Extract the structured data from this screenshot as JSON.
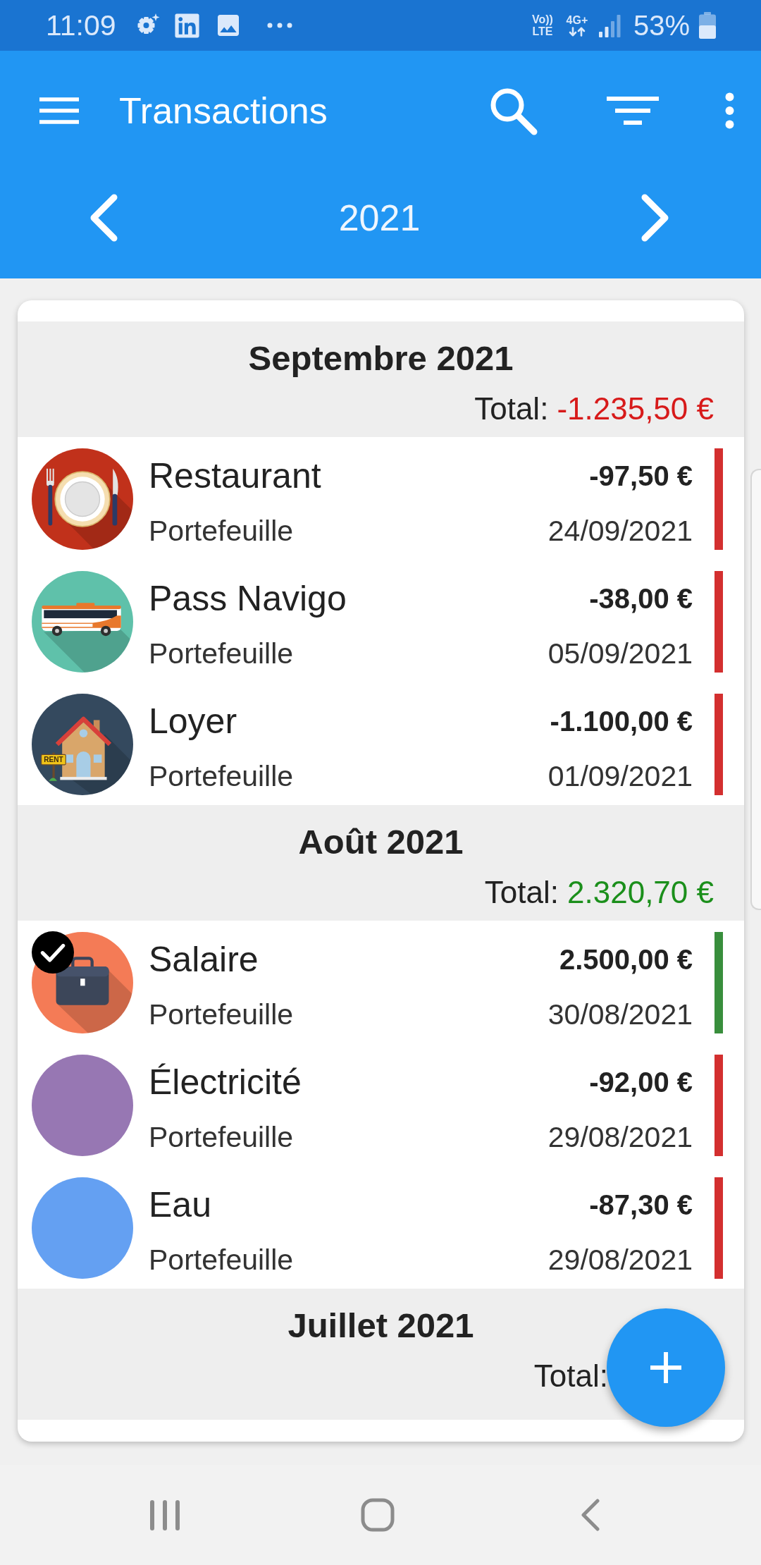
{
  "status_bar": {
    "time": "11:09",
    "volte": [
      "Vo))",
      "LTE"
    ],
    "network": "4G+",
    "battery": "53%"
  },
  "toolbar": {
    "title": "Transactions"
  },
  "year_selector": {
    "year": "2021"
  },
  "sections": [
    {
      "title": "Septembre 2021",
      "total": {
        "label": "Total:",
        "value": "-1.235,50 €",
        "positive": false
      },
      "transactions": [
        {
          "kind": "cutlery",
          "color": "#c1311b",
          "name": "Restaurant",
          "account": "Portefeuille",
          "amount": "-97,50 €",
          "date": "24/09/2021",
          "income": false,
          "selected": false
        },
        {
          "kind": "bus",
          "color": "#5fc1aa",
          "name": "Pass Navigo",
          "account": "Portefeuille",
          "amount": "-38,00 €",
          "date": "05/09/2021",
          "income": false,
          "selected": false
        },
        {
          "kind": "house",
          "color": "#34495e",
          "icon_label": "RENT",
          "name": "Loyer",
          "account": "Portefeuille",
          "amount": "-1.100,00 €",
          "date": "01/09/2021",
          "income": false,
          "selected": false
        }
      ]
    },
    {
      "title": "Août 2021",
      "total": {
        "label": "Total:",
        "value": "2.320,70 €",
        "positive": true
      },
      "transactions": [
        {
          "kind": "briefcase",
          "color": "#f47b56",
          "name": "Salaire",
          "account": "Portefeuille",
          "amount": "2.500,00 €",
          "date": "30/08/2021",
          "income": true,
          "selected": true
        },
        {
          "kind": "plain",
          "color": "#9777b3",
          "name": "Électricité",
          "account": "Portefeuille",
          "amount": "-92,00 €",
          "date": "29/08/2021",
          "income": false,
          "selected": false
        },
        {
          "kind": "plain",
          "color": "#64a0f2",
          "name": "Eau",
          "account": "Portefeuille",
          "amount": "-87,30 €",
          "date": "29/08/2021",
          "income": false,
          "selected": false
        }
      ]
    },
    {
      "title": "Juillet 2021",
      "total": {
        "label": "Total:"
      }
    }
  ]
}
